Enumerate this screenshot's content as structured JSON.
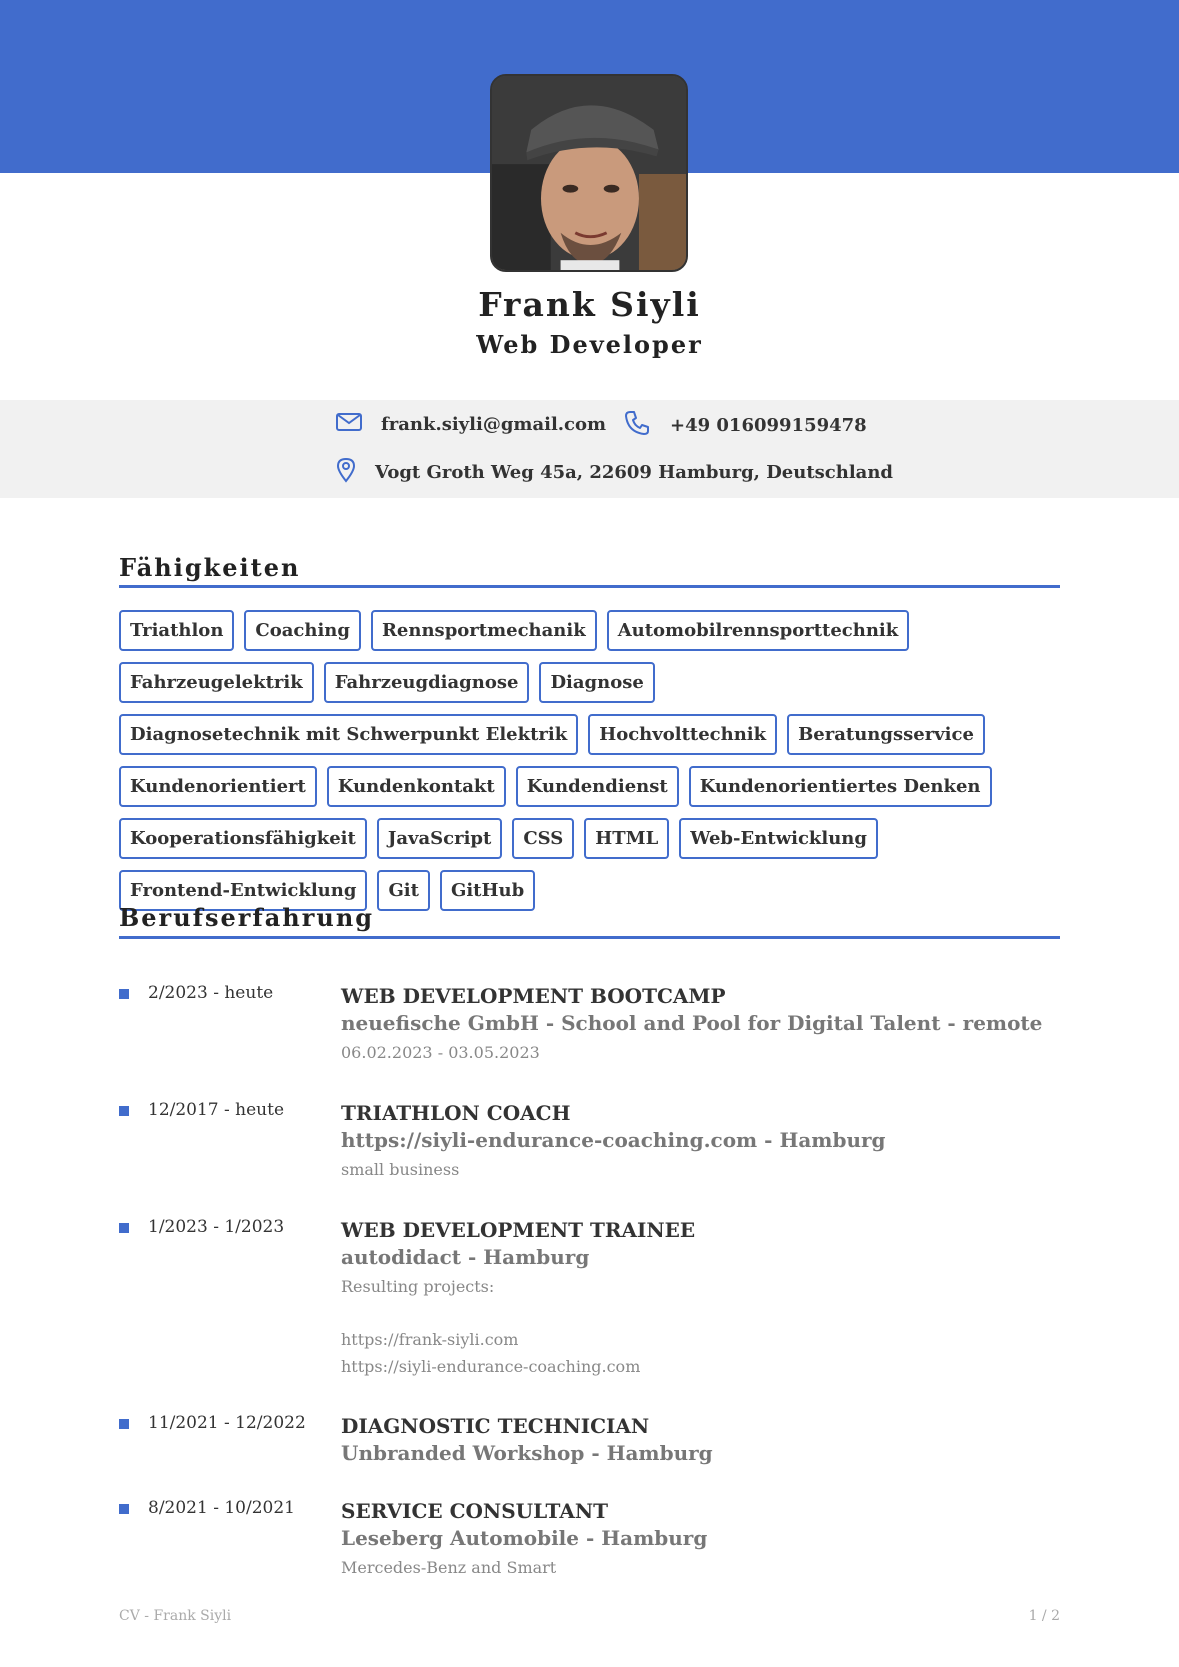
{
  "header": {
    "name": "Frank Siyli",
    "role": "Web Developer",
    "accent_color": "#416CCC"
  },
  "contact": {
    "email": "frank.siyli@gmail.com",
    "phone": "+49 016099159478",
    "address": "Vogt Groth Weg 45a, 22609 Hamburg, Deutschland",
    "icons": [
      "mail-icon",
      "phone-icon",
      "location-pin-icon"
    ]
  },
  "skills": {
    "heading": "Fähigkeiten",
    "items": [
      "Triathlon",
      "Coaching",
      "Rennsportmechanik",
      "Automobilrennsporttechnik",
      "Fahrzeugelektrik",
      "Fahrzeugdiagnose",
      "Diagnose",
      "Diagnosetechnik mit Schwerpunkt Elektrik",
      "Hochvolttechnik",
      "Beratungsservice",
      "Kundenorientiert",
      "Kundenkontakt",
      "Kundendienst",
      "Kundenorientiertes Denken",
      "Kooperationsfähigkeit",
      "JavaScript",
      "CSS",
      "HTML",
      "Web-Entwicklung",
      "Frontend-Entwicklung",
      "Git",
      "GitHub"
    ]
  },
  "experience": {
    "heading": "Berufserfahrung",
    "jobs": [
      {
        "period": "2/2023 - heute",
        "title": "WEB DEVELOPMENT BOOTCAMP",
        "company": "neuefische GmbH - School and Pool for Digital Talent - remote",
        "desc": [
          "06.02.2023 - 03.05.2023"
        ]
      },
      {
        "period": "12/2017 - heute",
        "title": "TRIATHLON COACH",
        "company": "https://siyli-endurance-coaching.com - Hamburg",
        "desc": [
          "small business"
        ]
      },
      {
        "period": "1/2023 - 1/2023",
        "title": "WEB DEVELOPMENT TRAINEE",
        "company": "autodidact - Hamburg",
        "desc": [
          "Resulting projects:",
          "",
          "https://frank-siyli.com",
          "https://siyli-endurance-coaching.com"
        ]
      },
      {
        "period": "11/2021 - 12/2022",
        "title": "DIAGNOSTIC TECHNICIAN",
        "company": "Unbranded Workshop - Hamburg",
        "desc": []
      },
      {
        "period": "8/2021 - 10/2021",
        "title": "SERVICE CONSULTANT",
        "company": "Leseberg Automobile - Hamburg",
        "desc": [
          "Mercedes-Benz and Smart"
        ]
      }
    ]
  },
  "footer": {
    "left": "CV - Frank Siyli",
    "right": "1 / 2"
  }
}
